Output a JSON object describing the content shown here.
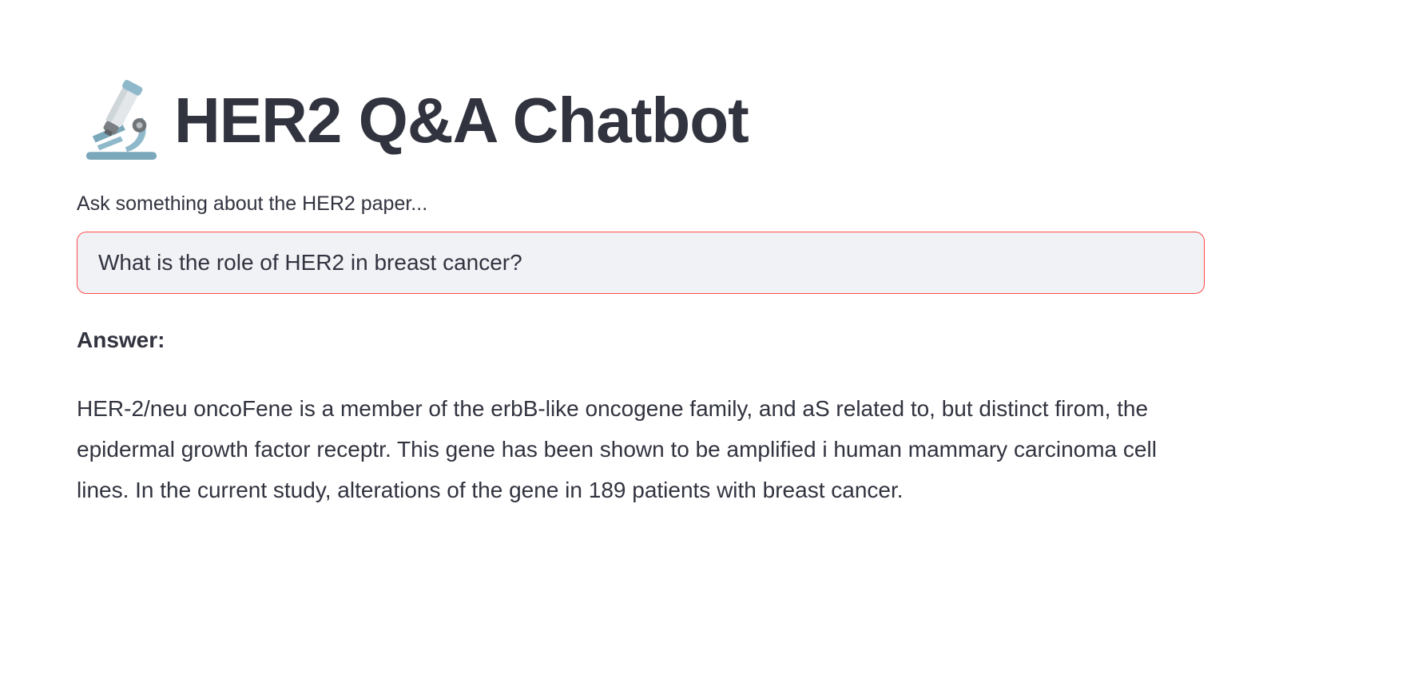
{
  "header": {
    "icon": "microscope-icon",
    "title": "HER2 Q&A Chatbot"
  },
  "query": {
    "label": "Ask something about the HER2 paper...",
    "value": "What is the role of HER2 in breast cancer?"
  },
  "answer": {
    "heading": "Answer:",
    "text": "HER-2/neu oncoFene is a member of the erbB-like oncogene family, and aS related to, but distinct firom, the epidermal growth factor receptr. This gene has been shown to be amplified i human mammary carcinoma cell lines. In the current study, alterations of the gene in 189 patients with breast cancer."
  },
  "colors": {
    "text": "#31333f",
    "input_background": "#f0f2f6",
    "input_focus_border": "#ff4b4b",
    "microscope_body": "#8fb9cb",
    "microscope_tube": "#e3e7ea"
  }
}
